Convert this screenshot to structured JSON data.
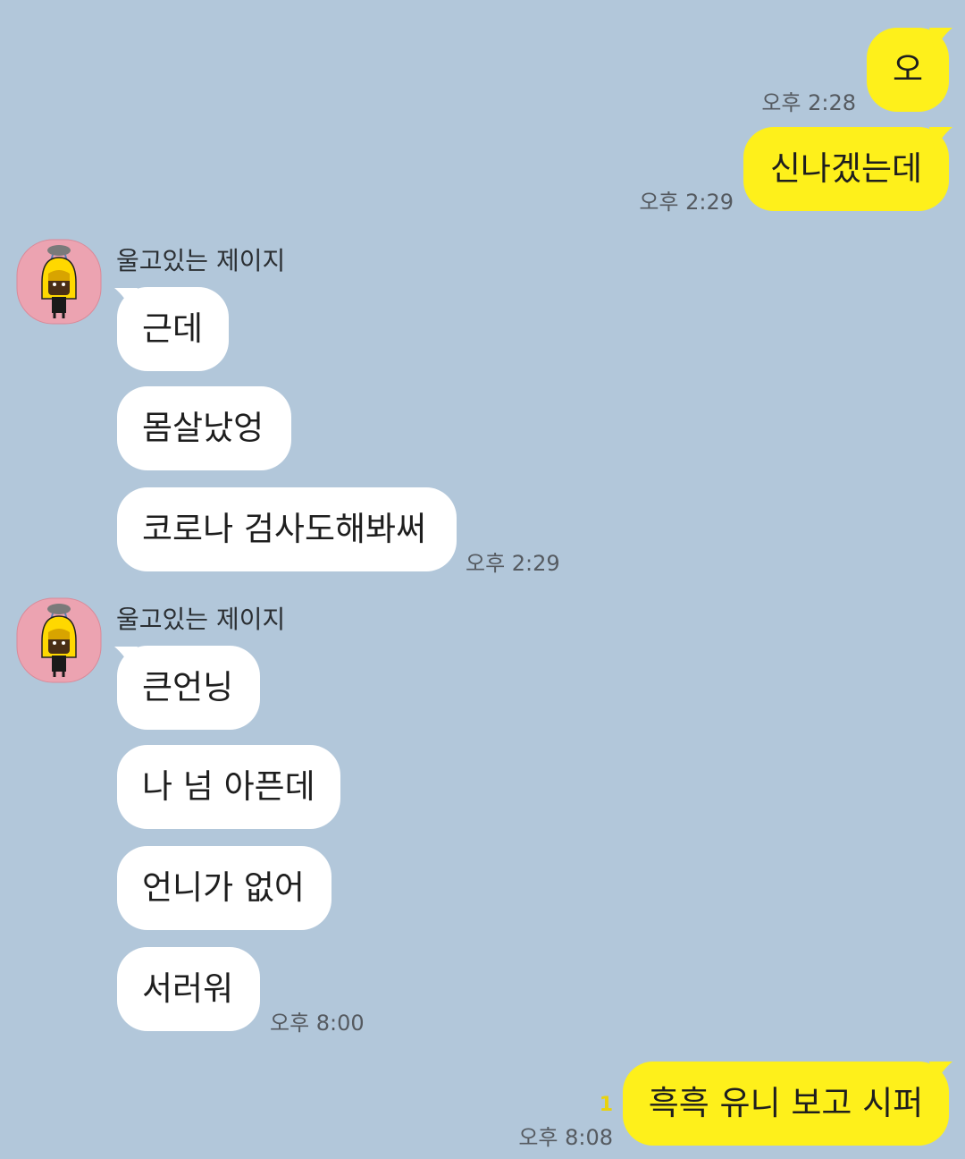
{
  "colors": {
    "background": "#b2c7da",
    "my_bubble": "#fef01b",
    "their_bubble": "#ffffff",
    "avatar_bg": "#eca3b1"
  },
  "messages": [
    {
      "from": "me",
      "text": "오",
      "time": "오후 2:28"
    },
    {
      "from": "me",
      "text": "신나겠는데",
      "time": "오후 2:29"
    },
    {
      "from": "them",
      "sender": "울고있는 제이지",
      "avatar_icon": "crying-jay-g-avatar-icon",
      "texts": [
        "근데",
        "몸살났엉",
        "코로나 검사도해봐써"
      ],
      "time": "오후 2:29"
    },
    {
      "from": "them",
      "sender": "울고있는 제이지",
      "avatar_icon": "crying-jay-g-avatar-icon",
      "texts": [
        "큰언닝",
        "나 넘 아픈데",
        "언니가 없어",
        "서러워"
      ],
      "time": "오후 8:00"
    },
    {
      "from": "me",
      "text": "흑흑 유니 보고 시퍼",
      "time": "오후 8:08",
      "unread_count": "1"
    }
  ]
}
